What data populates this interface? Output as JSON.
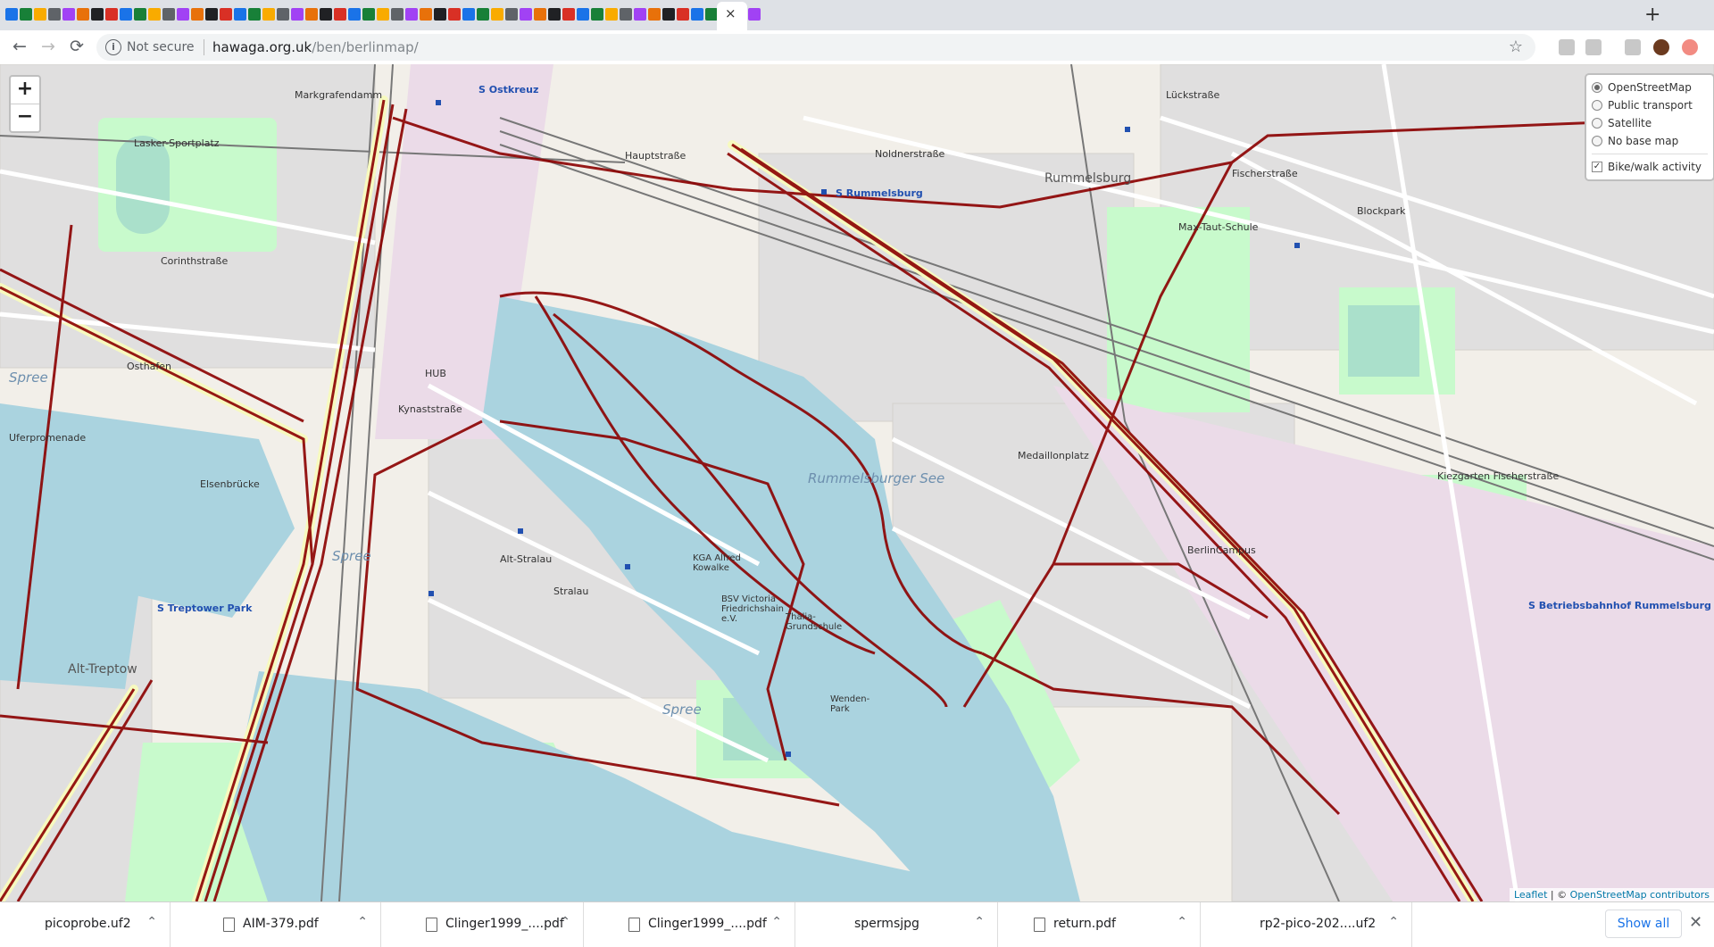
{
  "browser": {
    "close_tab_symbol": "×",
    "new_tab_symbol": "+",
    "nav": {
      "back": "←",
      "forward": "→",
      "reload": "⟳"
    },
    "omnibox": {
      "security_label": "Not secure",
      "domain": "hawaga.org.uk",
      "path": "/ben/berlinmap/",
      "info_symbol": "i",
      "star_symbol": "☆"
    }
  },
  "map": {
    "zoom_in": "+",
    "zoom_out": "−",
    "layers": {
      "base": [
        {
          "label": "OpenStreetMap",
          "selected": true
        },
        {
          "label": "Public transport",
          "selected": false
        },
        {
          "label": "Satellite",
          "selected": false
        },
        {
          "label": "No base map",
          "selected": false
        }
      ],
      "overlay": {
        "label": "Bike/walk activity",
        "checked": true
      }
    },
    "labels": {
      "rummelsburg": "Rummelsburg",
      "rummelsburger_see": "Rummelsburger See",
      "max_taut_schule": "Max-Taut-Schule",
      "lasker_sportplatz": "Lasker-Sportplatz",
      "s_rummelsburg": "S Rummelsburg",
      "s_ostkreuz": "S Ostkreuz",
      "s_treptower_park": "S Treptower Park",
      "s_betriebsbahnhof": "S Betriebsbahnhof Rummelsburg",
      "spree_1": "Spree",
      "spree_2": "Spree",
      "spree_3": "Spree",
      "elsenbrucke": "Elsenbrücke",
      "hauptstrasse": "Hauptstraße",
      "noldnerstrasse": "Noldnerstraße",
      "berlin_campus": "BerlinCampus",
      "medaillonplatz": "Medaillonplatz",
      "blockpark": "Blockpark",
      "kiezgarten": "Kiezgarten Fischerstraße",
      "alt_stralau": "Alt-Stralau",
      "stralau": "Stralau",
      "osthafen": "Osthafen",
      "markgrafendamm": "Markgrafendamm",
      "corinthstrasse": "Corinthstraße",
      "kynaststrasse": "Kynaststraße",
      "fischerstrasse": "Fischerstraße",
      "luckstrasse": "Lückstraße",
      "alt_treptow": "Alt-Treptow",
      "bsv_victoria": "BSV Victoria Friedrichshain e.V.",
      "thalia_grundschule": "Thalia-Grundschule",
      "kga_alfred_kowalke": "KGA Alfred Kowalke",
      "hub": "HUB",
      "uferpromenade": "Uferpromenade",
      "wendenpark": "Wenden-Park"
    },
    "attribution": {
      "leaflet": "Leaflet",
      "separator": " | © ",
      "osm": "OpenStreetMap contributors"
    },
    "colors": {
      "water": "#aad3df",
      "land": "#f2efe9",
      "residential": "#e0dfdf",
      "park": "#c8facc",
      "track": "#8b0000",
      "railway": "#777777",
      "road_major": "#f7fabf"
    }
  },
  "downloads": {
    "items": [
      {
        "name": "picoprobe.uf2",
        "icon": "file-icon"
      },
      {
        "name": "AIM-379.pdf",
        "icon": "document-icon"
      },
      {
        "name": "Clinger1999_....pdf",
        "icon": "document-icon"
      },
      {
        "name": "Clinger1999_....pdf",
        "icon": "document-icon"
      },
      {
        "name": "spermsjpg",
        "icon": "file-icon"
      },
      {
        "name": "return.pdf",
        "icon": "document-icon"
      },
      {
        "name": "rp2-pico-202....uf2",
        "icon": "file-icon"
      }
    ],
    "show_all": "Show all",
    "close_symbol": "✕"
  }
}
